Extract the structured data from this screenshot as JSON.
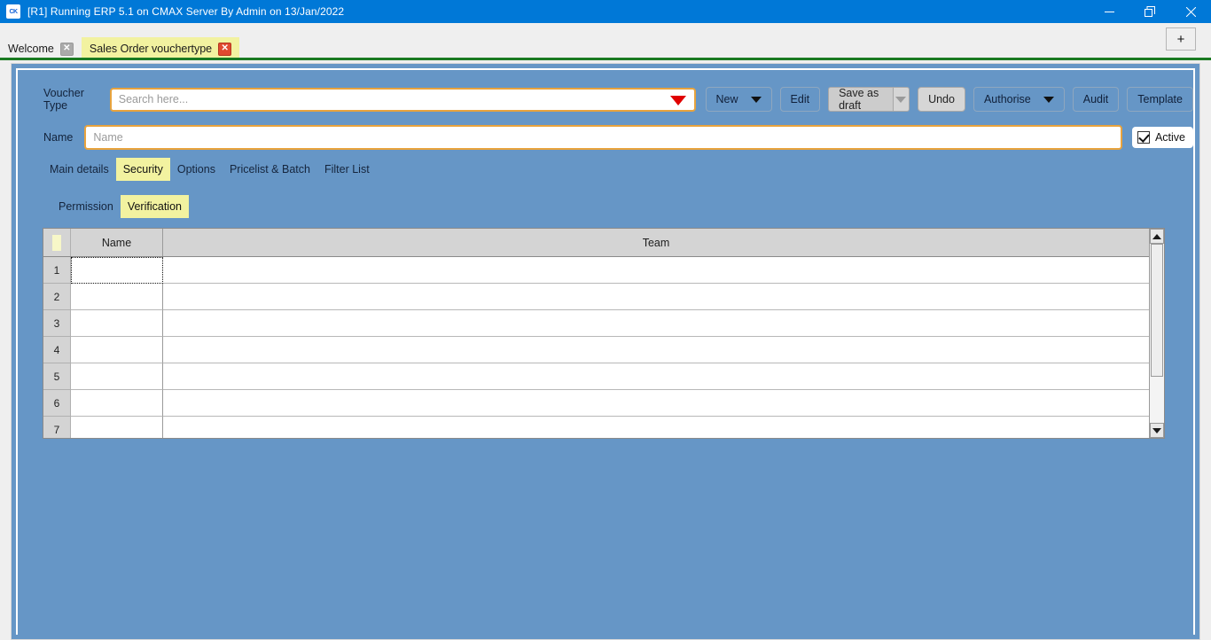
{
  "window": {
    "title": "[R1] Running ERP 5.1 on CMAX Server By Admin on 13/Jan/2022",
    "app_icon": "ck-app-icon",
    "minimize_label": "Minimize",
    "restore_label": "Restore",
    "close_label": "Close"
  },
  "tabs": {
    "items": [
      {
        "label": "Welcome",
        "active": false,
        "close_icon": "close-icon"
      },
      {
        "label": "Sales Order vouchertype",
        "active": true,
        "close_icon": "close-icon"
      }
    ],
    "add_tab_label": "+"
  },
  "form": {
    "voucher_type_label": "Voucher Type",
    "voucher_type_placeholder": "Search here...",
    "voucher_type_value": "",
    "name_label": "Name",
    "name_placeholder": "Name",
    "name_value": "",
    "active_label": "Active",
    "active_checked": true
  },
  "toolbar": {
    "new_label": "New",
    "edit_label": "Edit",
    "save_as_draft_label": "Save as draft",
    "undo_label": "Undo",
    "authorise_label": "Authorise",
    "audit_label": "Audit",
    "template_label": "Template"
  },
  "main_tabs": {
    "items": [
      {
        "label": "Main details",
        "active": false
      },
      {
        "label": "Security",
        "active": true
      },
      {
        "label": "Options",
        "active": false
      },
      {
        "label": "Pricelist & Batch",
        "active": false
      },
      {
        "label": "Filter List",
        "active": false
      }
    ]
  },
  "sub_tabs": {
    "items": [
      {
        "label": "Permission",
        "active": false
      },
      {
        "label": "Verification",
        "active": true
      }
    ]
  },
  "grid": {
    "columns": [
      "Name",
      "Team"
    ],
    "rows": [
      {
        "num": "1",
        "name": "",
        "team": "",
        "selected": true
      },
      {
        "num": "2",
        "name": "",
        "team": "",
        "selected": false
      },
      {
        "num": "3",
        "name": "",
        "team": "",
        "selected": false
      },
      {
        "num": "4",
        "name": "",
        "team": "",
        "selected": false
      },
      {
        "num": "5",
        "name": "",
        "team": "",
        "selected": false
      },
      {
        "num": "6",
        "name": "",
        "team": "",
        "selected": false
      },
      {
        "num": "7",
        "name": "",
        "team": "",
        "selected": false
      }
    ],
    "scroll_up_icon": "arrow-up-icon",
    "scroll_down_icon": "arrow-down-icon"
  },
  "colors": {
    "titlebar": "#0078d7",
    "panel": "#6696c6",
    "active_tab": "#f2f2a0",
    "field_border": "#e8a33d",
    "green_rule": "#1a7a21",
    "dropdown_caret": "#e00000"
  }
}
